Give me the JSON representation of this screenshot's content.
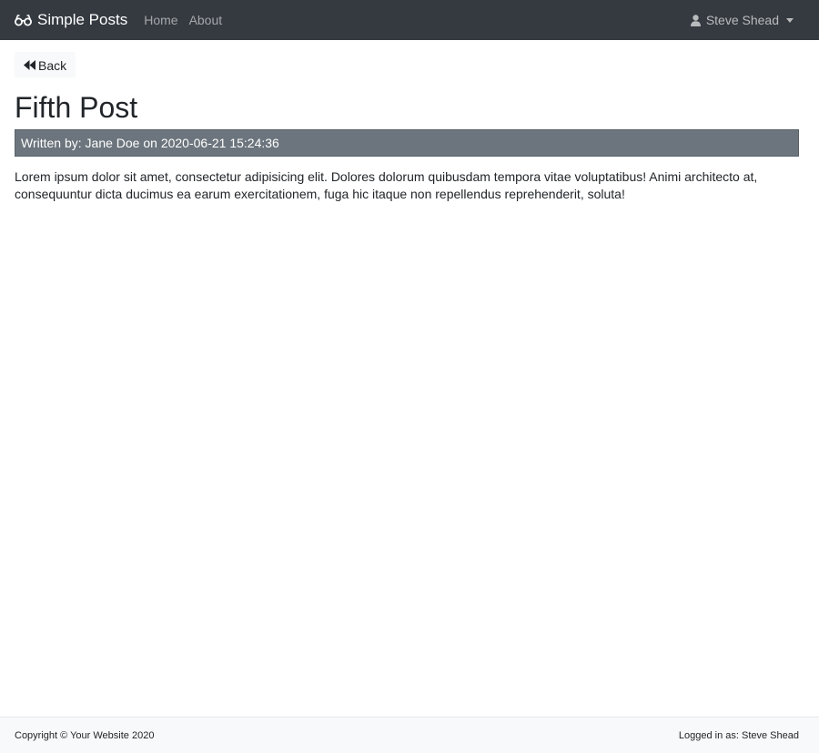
{
  "navbar": {
    "brand_label": "Simple Posts",
    "brand_icon": "glasses-icon",
    "links": [
      {
        "label": "Home"
      },
      {
        "label": "About"
      }
    ],
    "user": {
      "name": "Steve Shead",
      "icon": "user-icon"
    }
  },
  "back_button": {
    "label": "Back",
    "icon": "backward-icon"
  },
  "post": {
    "title": "Fifth Post",
    "byline": "Written by: Jane Doe on 2020-06-21 15:24:36",
    "body": "Lorem ipsum dolor sit amet, consectetur adipisicing elit. Dolores dolorum quibusdam tempora vitae voluptatibus! Animi architecto at, consequuntur dicta ducimus ea earum exercitationem, fuga hic itaque non repellendus reprehenderit, soluta!"
  },
  "footer": {
    "copyright": "Copyright © Your Website 2020",
    "logged_in": "Logged in as: Steve Shead"
  },
  "colors": {
    "navbar_bg": "#343a40",
    "byline_bg": "#6c757d",
    "footer_bg": "#f8f9fa"
  }
}
